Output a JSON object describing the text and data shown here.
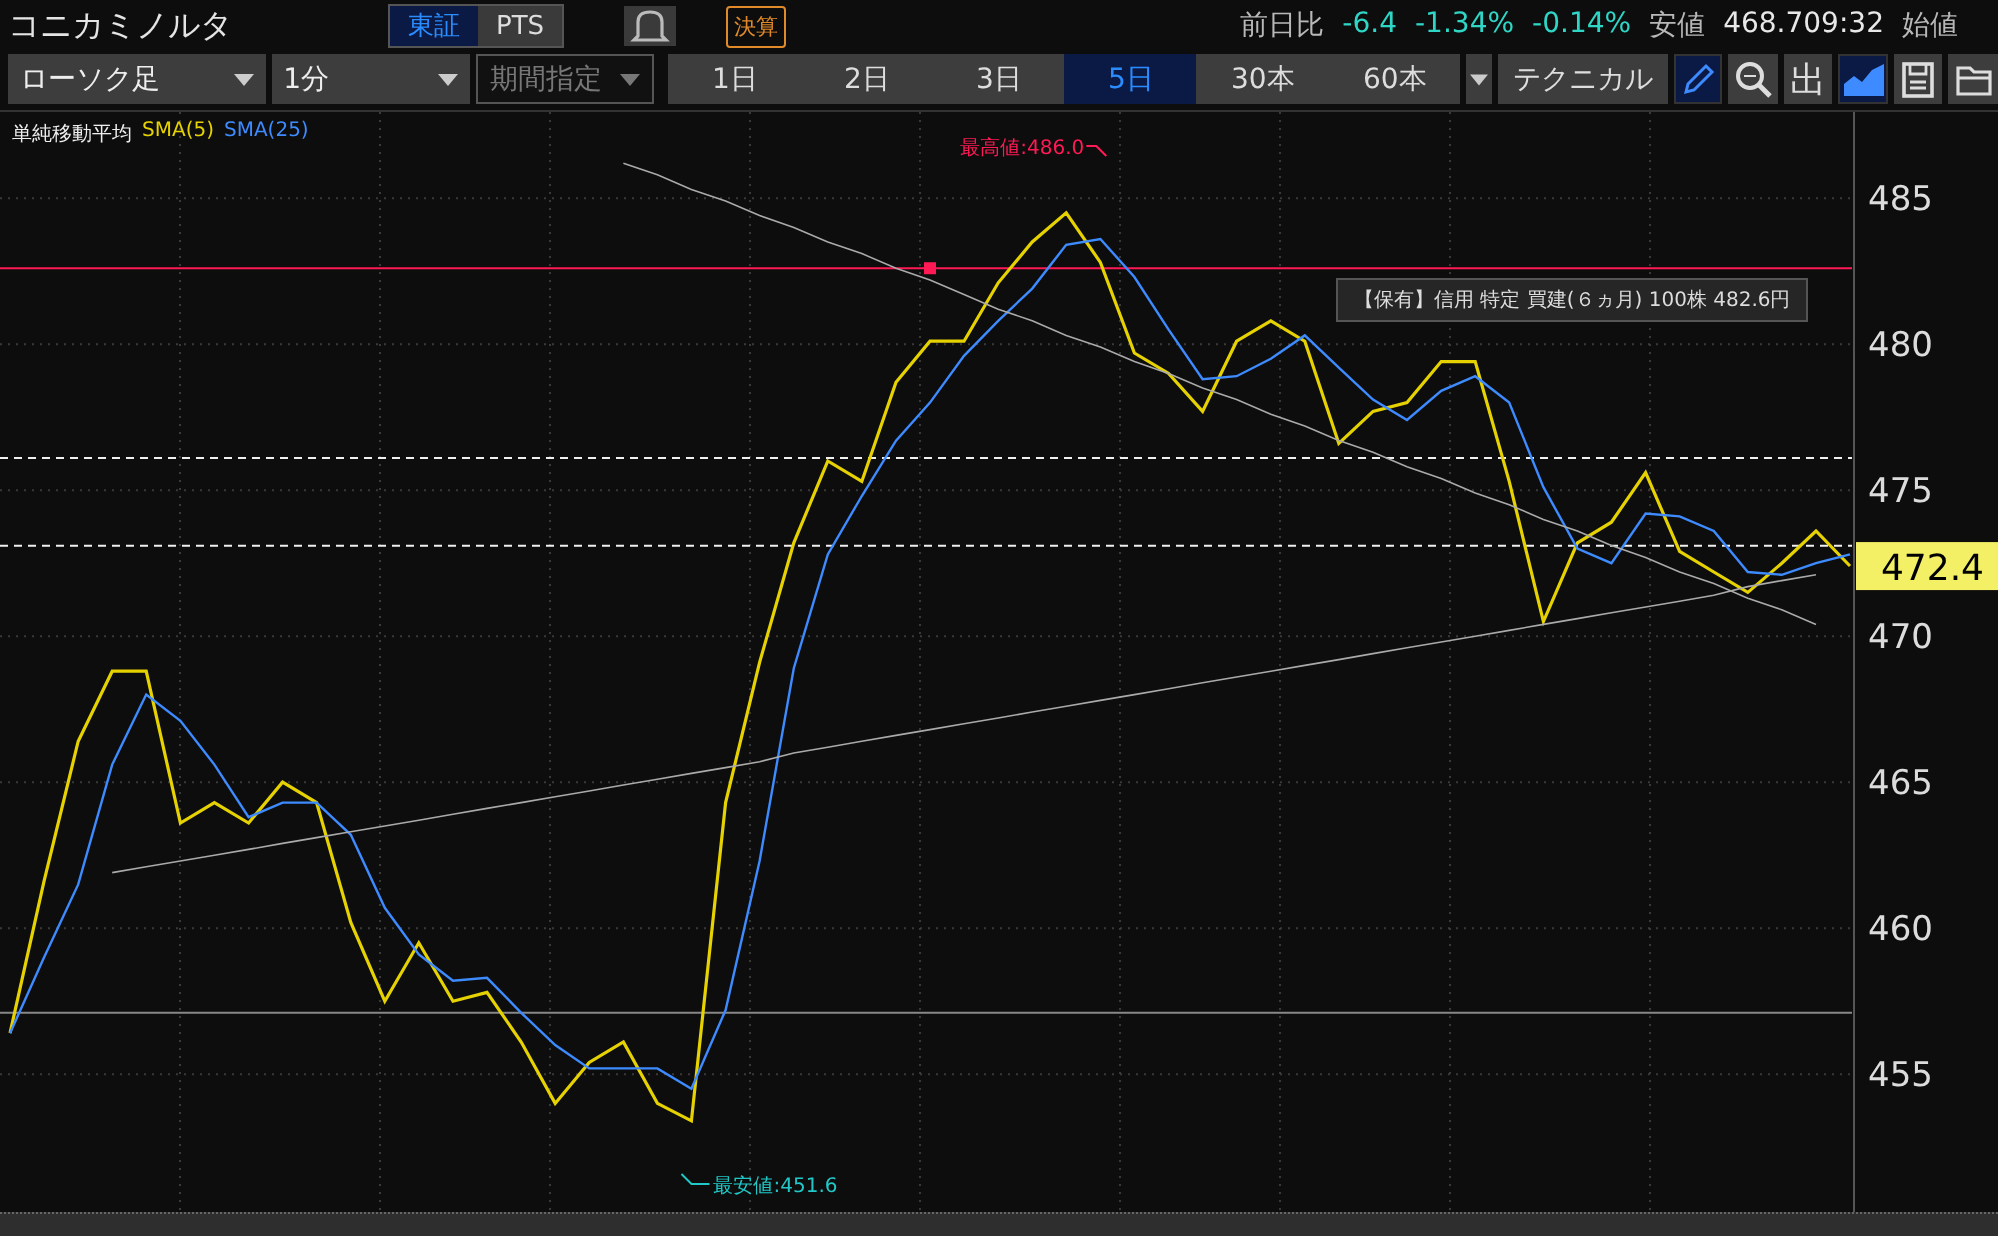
{
  "header": {
    "title": "コニカミノルタ",
    "markets": [
      {
        "label": "東証",
        "selected": true
      },
      {
        "label": "PTS",
        "selected": false
      }
    ],
    "badge": "決算",
    "stats": [
      {
        "text": "前日比",
        "kind": "label"
      },
      {
        "text": "-6.4",
        "kind": "change"
      },
      {
        "text": "-1.34%",
        "kind": "change"
      },
      {
        "text": "-0.14%",
        "kind": "change"
      },
      {
        "text": "安値",
        "kind": "label"
      },
      {
        "text": "468.709:32",
        "kind": "value"
      },
      {
        "text": "始値",
        "kind": "label"
      }
    ]
  },
  "toolbar": {
    "dropdowns": [
      {
        "label": "ローソク足",
        "disabled": false
      },
      {
        "label": "1分",
        "disabled": false
      },
      {
        "label": "期間指定",
        "disabled": true
      }
    ],
    "periods": [
      {
        "label": "1日",
        "selected": false
      },
      {
        "label": "2日",
        "selected": false
      },
      {
        "label": "3日",
        "selected": false
      },
      {
        "label": "5日",
        "selected": true
      },
      {
        "label": "30本",
        "selected": false
      },
      {
        "label": "60本",
        "selected": false
      }
    ],
    "technical": "テクニカル",
    "tools": [
      {
        "kind": "pencil",
        "selected": true
      },
      {
        "kind": "zoom",
        "selected": false
      },
      {
        "kind": "glyph",
        "label": "出",
        "selected": false
      },
      {
        "kind": "area",
        "selected": true
      },
      {
        "kind": "save",
        "selected": false
      },
      {
        "kind": "folder",
        "selected": false
      }
    ]
  },
  "chart": {
    "indicator": "単純移動平均",
    "current_price": "472.4",
    "chart_data": {
      "type": "line",
      "ylim": [
        450.28,
        487.95
      ],
      "yticks": [
        455,
        460,
        465,
        470,
        475,
        480,
        485
      ],
      "series": [
        {
          "name": "SMA(5)",
          "color": "#e6d200",
          "values": [
            456.4,
            461.6,
            466.4,
            468.8,
            468.8,
            463.6,
            464.3,
            463.6,
            465.0,
            464.3,
            460.2,
            457.5,
            459.5,
            457.5,
            457.8,
            456.1,
            454.0,
            455.4,
            456.1,
            454.0,
            453.4,
            464.3,
            469.1,
            473.2,
            476.0,
            475.3,
            478.7,
            480.1,
            480.1,
            482.1,
            483.5,
            484.5,
            482.8,
            479.7,
            479.0,
            477.7,
            480.1,
            480.8,
            480.1,
            476.6,
            477.7,
            478.0,
            479.4,
            479.4,
            475.3,
            470.5,
            473.2,
            473.9,
            475.6,
            472.9,
            472.2,
            471.5,
            472.5,
            473.6,
            472.4
          ]
        },
        {
          "name": "SMA(25)",
          "color": "#3d8bff",
          "values": [
            456.4,
            459.0,
            461.5,
            465.6,
            468.0,
            467.1,
            465.6,
            463.8,
            464.3,
            464.3,
            463.2,
            460.7,
            459.1,
            458.2,
            458.3,
            457.1,
            456.0,
            455.2,
            455.2,
            455.2,
            454.5,
            457.2,
            462.3,
            468.9,
            472.8,
            474.8,
            476.7,
            478.0,
            479.6,
            480.8,
            481.9,
            483.4,
            483.6,
            482.3,
            480.5,
            478.8,
            478.9,
            479.5,
            480.3,
            479.2,
            478.1,
            477.4,
            478.4,
            478.9,
            478.0,
            475.1,
            473.0,
            472.5,
            474.2,
            474.1,
            473.6,
            472.2,
            472.1,
            472.5,
            472.8
          ]
        },
        {
          "color": "#aaaaaa",
          "values": [
            null,
            null,
            null,
            null,
            null,
            null,
            null,
            null,
            null,
            null,
            null,
            null,
            null,
            null,
            null,
            null,
            null,
            null,
            486.2,
            485.8,
            485.3,
            484.9,
            484.4,
            484.0,
            483.5,
            483.1,
            482.6,
            482.2,
            481.7,
            481.2,
            480.8,
            480.3,
            479.9,
            479.4,
            479.0,
            478.5,
            478.1,
            477.6,
            477.2,
            476.7,
            476.3,
            475.8,
            475.4,
            474.9,
            474.5,
            474.0,
            473.6,
            473.1,
            472.7,
            472.2,
            471.8,
            471.3,
            470.9,
            470.4,
            null
          ]
        },
        {
          "color": "#aaaaaa",
          "values": [
            null,
            null,
            null,
            461.9,
            462.1,
            462.3,
            462.5,
            462.7,
            462.9,
            463.1,
            463.3,
            463.5,
            463.7,
            463.9,
            464.1,
            464.3,
            464.5,
            464.7,
            464.9,
            465.1,
            465.3,
            465.5,
            465.7,
            466.0,
            466.2,
            466.4,
            466.6,
            466.8,
            467.0,
            467.2,
            467.4,
            467.6,
            467.8,
            468.0,
            468.2,
            468.4,
            468.6,
            468.8,
            469.0,
            469.2,
            469.4,
            469.6,
            469.8,
            470.0,
            470.2,
            470.4,
            470.6,
            470.8,
            471.0,
            471.2,
            471.4,
            471.7,
            471.9,
            472.1,
            null
          ]
        }
      ],
      "grid": true,
      "ref_lines": [
        {
          "axis": "y",
          "value": 482.6,
          "color": "#ff1a55"
        },
        {
          "axis": "y",
          "value": 476.1,
          "color": "#f0f0f0"
        },
        {
          "axis": "y",
          "value": 473.1,
          "color": "#f0f0f0"
        },
        {
          "axis": "y",
          "value": 457.1,
          "color": "#888888"
        }
      ],
      "annotations": [
        "最高値:486.0",
        "最安値:451.6",
        "【保有】信用 特定 買建(６ヵ月) 100株 482.6円"
      ]
    }
  }
}
